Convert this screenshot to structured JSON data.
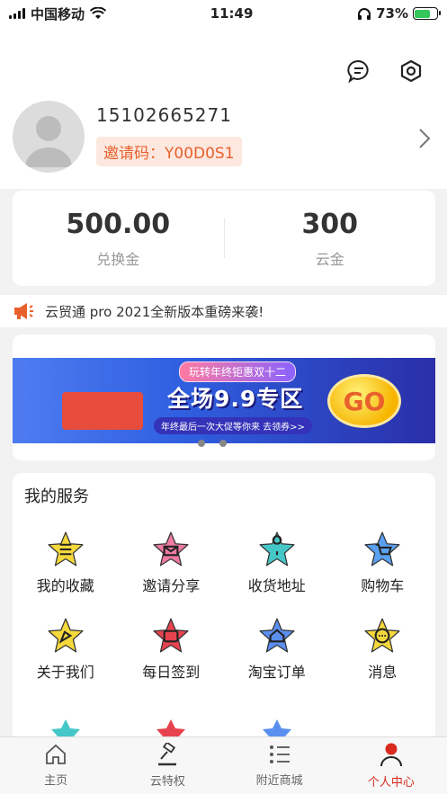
{
  "status_bar": {
    "carrier": "中国移动",
    "time": "11:49",
    "battery": "73%",
    "battery_level": 0.73
  },
  "profile": {
    "phone": "15102665271",
    "invite": "邀请码：Y00D0S1"
  },
  "stats": [
    {
      "value": "500.00",
      "label": "兑换金"
    },
    {
      "value": "300",
      "label": "云金"
    }
  ],
  "notice": "云贸通 pro 2021全新版本重磅来袭!",
  "banner": {
    "top_text": "玩转年终钜惠双十二",
    "main_text": "全场9.9专区",
    "sub_text": "年终最后一次大促等你来 去领券>>",
    "go": "GO"
  },
  "services": {
    "title": "我的服务",
    "items": [
      {
        "label": "我的收藏",
        "color": "#f5d83c",
        "icon": "favorites-icon"
      },
      {
        "label": "邀请分享",
        "color": "#f07aa3",
        "icon": "share-icon"
      },
      {
        "label": "收货地址",
        "color": "#46c7c7",
        "icon": "address-icon"
      },
      {
        "label": "购物车",
        "color": "#5aa0f0",
        "icon": "cart-icon"
      },
      {
        "label": "关于我们",
        "color": "#f5d83c",
        "icon": "about-icon"
      },
      {
        "label": "每日签到",
        "color": "#e7434e",
        "icon": "checkin-icon"
      },
      {
        "label": "淘宝订单",
        "color": "#5a8ff0",
        "icon": "orders-icon"
      },
      {
        "label": "消息",
        "color": "#f5d83c",
        "icon": "message-icon"
      }
    ]
  },
  "tabs": [
    {
      "label": "主页",
      "icon": "home-icon"
    },
    {
      "label": "云特权",
      "icon": "gavel-icon"
    },
    {
      "label": "附近商城",
      "icon": "list-icon"
    },
    {
      "label": "个人中心",
      "icon": "profile-icon",
      "active": true
    }
  ]
}
